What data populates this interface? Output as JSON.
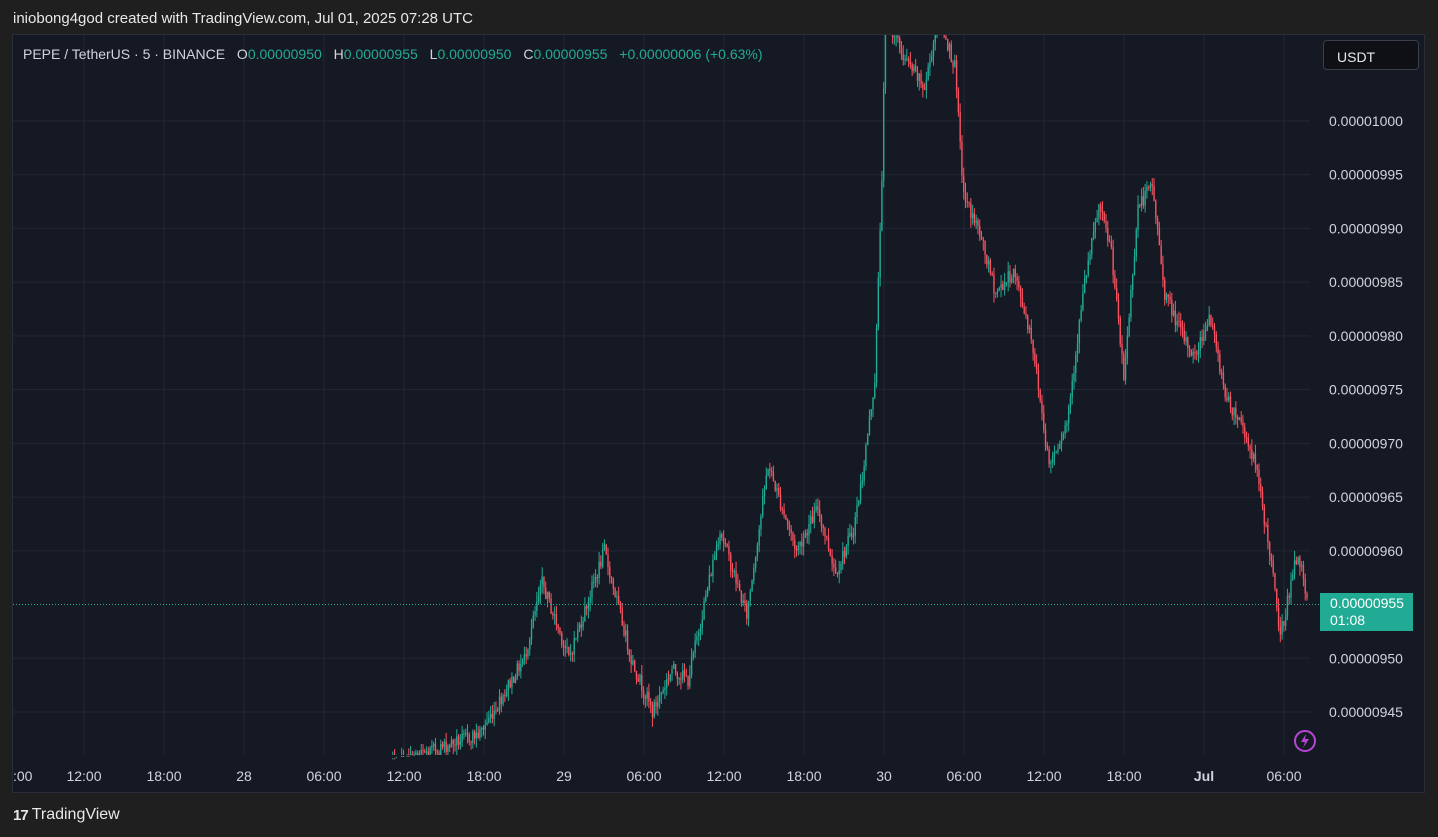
{
  "header": {
    "created_by": "iniobong4god created with TradingView.com, Jul 01, 2025 07:28 UTC"
  },
  "legend": {
    "symbol": "PEPE / TetherUS · 5 · BINANCE",
    "o_label": "O",
    "o_value": "0.00000950",
    "h_label": "H",
    "h_value": "0.00000955",
    "l_label": "L",
    "l_value": "0.00000950",
    "c_label": "C",
    "c_value": "0.00000955",
    "change": "+0.00000006 (+0.63%)"
  },
  "currency_button": {
    "label": "USDT"
  },
  "last_price": {
    "price": "0.00000955",
    "countdown": "01:08"
  },
  "brand": {
    "logo": "17",
    "name": "TradingView"
  },
  "icons": {
    "bolt": "bolt-icon",
    "logo": "tradingview-logo-icon"
  },
  "colors": {
    "up": "#22ab94",
    "down": "#f7525f",
    "background": "#151924",
    "grid": "#232733",
    "accent": "#b746d6"
  },
  "chart_data": {
    "type": "candlestick",
    "y_ticks": [
      "0.00001000",
      "0.00000995",
      "0.00000990",
      "0.00000985",
      "0.00000980",
      "0.00000975",
      "0.00000970",
      "0.00000965",
      "0.00000960",
      "0.00000950",
      "0.00000945"
    ],
    "x_ticks": [
      ":00",
      "12:00",
      "18:00",
      "28",
      "06:00",
      "12:00",
      "18:00",
      "29",
      "06:00",
      "12:00",
      "18:00",
      "30",
      "06:00",
      "12:00",
      "18:00",
      "Jul",
      "06:00"
    ],
    "x_bold": [
      false,
      false,
      false,
      false,
      false,
      false,
      false,
      false,
      false,
      false,
      false,
      false,
      false,
      false,
      false,
      true,
      false
    ],
    "last_price": 9.55e-06,
    "ylim": [
      9.41e-06,
      1.008e-05
    ],
    "series_path": [
      [
        0,
        9.4e-06
      ],
      [
        50,
        9.43e-06
      ],
      [
        75,
        9.5e-06
      ],
      [
        85,
        9.57e-06
      ],
      [
        100,
        9.5e-06
      ],
      [
        120,
        9.6e-06
      ],
      [
        135,
        9.5e-06
      ],
      [
        147,
        9.45e-06
      ],
      [
        158,
        9.49e-06
      ],
      [
        167,
        9.48e-06
      ],
      [
        176,
        9.55e-06
      ],
      [
        185,
        9.62e-06
      ],
      [
        200,
        9.54e-06
      ],
      [
        212,
        9.68e-06
      ],
      [
        228,
        9.6e-06
      ],
      [
        240,
        9.64e-06
      ],
      [
        250,
        9.58e-06
      ],
      [
        260,
        9.62e-06
      ],
      [
        265,
        9.67e-06
      ],
      [
        272,
        9.76e-06
      ],
      [
        274,
        9.85e-06
      ],
      [
        276,
        9.95e-06
      ],
      [
        278,
        1.01e-05
      ],
      [
        288,
        1.006e-05
      ],
      [
        300,
        1.003e-05
      ],
      [
        308,
        1.01e-05
      ],
      [
        317,
        1.005e-05
      ],
      [
        322,
        9.93e-06
      ],
      [
        330,
        9.9e-06
      ],
      [
        340,
        9.84e-06
      ],
      [
        350,
        9.86e-06
      ],
      [
        360,
        9.8e-06
      ],
      [
        370,
        9.68e-06
      ],
      [
        380,
        9.72e-06
      ],
      [
        390,
        9.85e-06
      ],
      [
        398,
        9.92e-06
      ],
      [
        405,
        9.88e-06
      ],
      [
        412,
        9.76e-06
      ],
      [
        420,
        9.92e-06
      ],
      [
        428,
        9.94e-06
      ],
      [
        435,
        9.84e-06
      ],
      [
        445,
        9.8e-06
      ],
      [
        452,
        9.78e-06
      ],
      [
        460,
        9.82e-06
      ],
      [
        470,
        9.74e-06
      ],
      [
        478,
        9.72e-06
      ],
      [
        486,
        9.68e-06
      ],
      [
        494,
        9.6e-06
      ],
      [
        500,
        9.52e-06
      ],
      [
        506,
        9.57e-06
      ],
      [
        510,
        9.6e-06
      ],
      [
        515,
        9.55e-06
      ]
    ]
  }
}
